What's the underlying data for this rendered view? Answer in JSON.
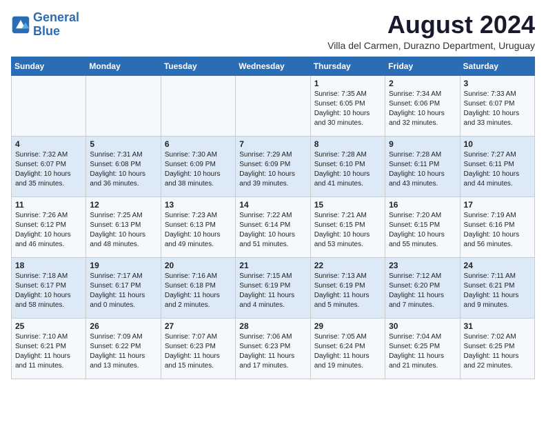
{
  "header": {
    "logo_line1": "General",
    "logo_line2": "Blue",
    "month_year": "August 2024",
    "location": "Villa del Carmen, Durazno Department, Uruguay"
  },
  "days_of_week": [
    "Sunday",
    "Monday",
    "Tuesday",
    "Wednesday",
    "Thursday",
    "Friday",
    "Saturday"
  ],
  "weeks": [
    [
      {
        "day": "",
        "info": ""
      },
      {
        "day": "",
        "info": ""
      },
      {
        "day": "",
        "info": ""
      },
      {
        "day": "",
        "info": ""
      },
      {
        "day": "1",
        "info": "Sunrise: 7:35 AM\nSunset: 6:05 PM\nDaylight: 10 hours and 30 minutes."
      },
      {
        "day": "2",
        "info": "Sunrise: 7:34 AM\nSunset: 6:06 PM\nDaylight: 10 hours and 32 minutes."
      },
      {
        "day": "3",
        "info": "Sunrise: 7:33 AM\nSunset: 6:07 PM\nDaylight: 10 hours and 33 minutes."
      }
    ],
    [
      {
        "day": "4",
        "info": "Sunrise: 7:32 AM\nSunset: 6:07 PM\nDaylight: 10 hours and 35 minutes."
      },
      {
        "day": "5",
        "info": "Sunrise: 7:31 AM\nSunset: 6:08 PM\nDaylight: 10 hours and 36 minutes."
      },
      {
        "day": "6",
        "info": "Sunrise: 7:30 AM\nSunset: 6:09 PM\nDaylight: 10 hours and 38 minutes."
      },
      {
        "day": "7",
        "info": "Sunrise: 7:29 AM\nSunset: 6:09 PM\nDaylight: 10 hours and 39 minutes."
      },
      {
        "day": "8",
        "info": "Sunrise: 7:28 AM\nSunset: 6:10 PM\nDaylight: 10 hours and 41 minutes."
      },
      {
        "day": "9",
        "info": "Sunrise: 7:28 AM\nSunset: 6:11 PM\nDaylight: 10 hours and 43 minutes."
      },
      {
        "day": "10",
        "info": "Sunrise: 7:27 AM\nSunset: 6:11 PM\nDaylight: 10 hours and 44 minutes."
      }
    ],
    [
      {
        "day": "11",
        "info": "Sunrise: 7:26 AM\nSunset: 6:12 PM\nDaylight: 10 hours and 46 minutes."
      },
      {
        "day": "12",
        "info": "Sunrise: 7:25 AM\nSunset: 6:13 PM\nDaylight: 10 hours and 48 minutes."
      },
      {
        "day": "13",
        "info": "Sunrise: 7:23 AM\nSunset: 6:13 PM\nDaylight: 10 hours and 49 minutes."
      },
      {
        "day": "14",
        "info": "Sunrise: 7:22 AM\nSunset: 6:14 PM\nDaylight: 10 hours and 51 minutes."
      },
      {
        "day": "15",
        "info": "Sunrise: 7:21 AM\nSunset: 6:15 PM\nDaylight: 10 hours and 53 minutes."
      },
      {
        "day": "16",
        "info": "Sunrise: 7:20 AM\nSunset: 6:15 PM\nDaylight: 10 hours and 55 minutes."
      },
      {
        "day": "17",
        "info": "Sunrise: 7:19 AM\nSunset: 6:16 PM\nDaylight: 10 hours and 56 minutes."
      }
    ],
    [
      {
        "day": "18",
        "info": "Sunrise: 7:18 AM\nSunset: 6:17 PM\nDaylight: 10 hours and 58 minutes."
      },
      {
        "day": "19",
        "info": "Sunrise: 7:17 AM\nSunset: 6:17 PM\nDaylight: 11 hours and 0 minutes."
      },
      {
        "day": "20",
        "info": "Sunrise: 7:16 AM\nSunset: 6:18 PM\nDaylight: 11 hours and 2 minutes."
      },
      {
        "day": "21",
        "info": "Sunrise: 7:15 AM\nSunset: 6:19 PM\nDaylight: 11 hours and 4 minutes."
      },
      {
        "day": "22",
        "info": "Sunrise: 7:13 AM\nSunset: 6:19 PM\nDaylight: 11 hours and 5 minutes."
      },
      {
        "day": "23",
        "info": "Sunrise: 7:12 AM\nSunset: 6:20 PM\nDaylight: 11 hours and 7 minutes."
      },
      {
        "day": "24",
        "info": "Sunrise: 7:11 AM\nSunset: 6:21 PM\nDaylight: 11 hours and 9 minutes."
      }
    ],
    [
      {
        "day": "25",
        "info": "Sunrise: 7:10 AM\nSunset: 6:21 PM\nDaylight: 11 hours and 11 minutes."
      },
      {
        "day": "26",
        "info": "Sunrise: 7:09 AM\nSunset: 6:22 PM\nDaylight: 11 hours and 13 minutes."
      },
      {
        "day": "27",
        "info": "Sunrise: 7:07 AM\nSunset: 6:23 PM\nDaylight: 11 hours and 15 minutes."
      },
      {
        "day": "28",
        "info": "Sunrise: 7:06 AM\nSunset: 6:23 PM\nDaylight: 11 hours and 17 minutes."
      },
      {
        "day": "29",
        "info": "Sunrise: 7:05 AM\nSunset: 6:24 PM\nDaylight: 11 hours and 19 minutes."
      },
      {
        "day": "30",
        "info": "Sunrise: 7:04 AM\nSunset: 6:25 PM\nDaylight: 11 hours and 21 minutes."
      },
      {
        "day": "31",
        "info": "Sunrise: 7:02 AM\nSunset: 6:25 PM\nDaylight: 11 hours and 22 minutes."
      }
    ]
  ]
}
